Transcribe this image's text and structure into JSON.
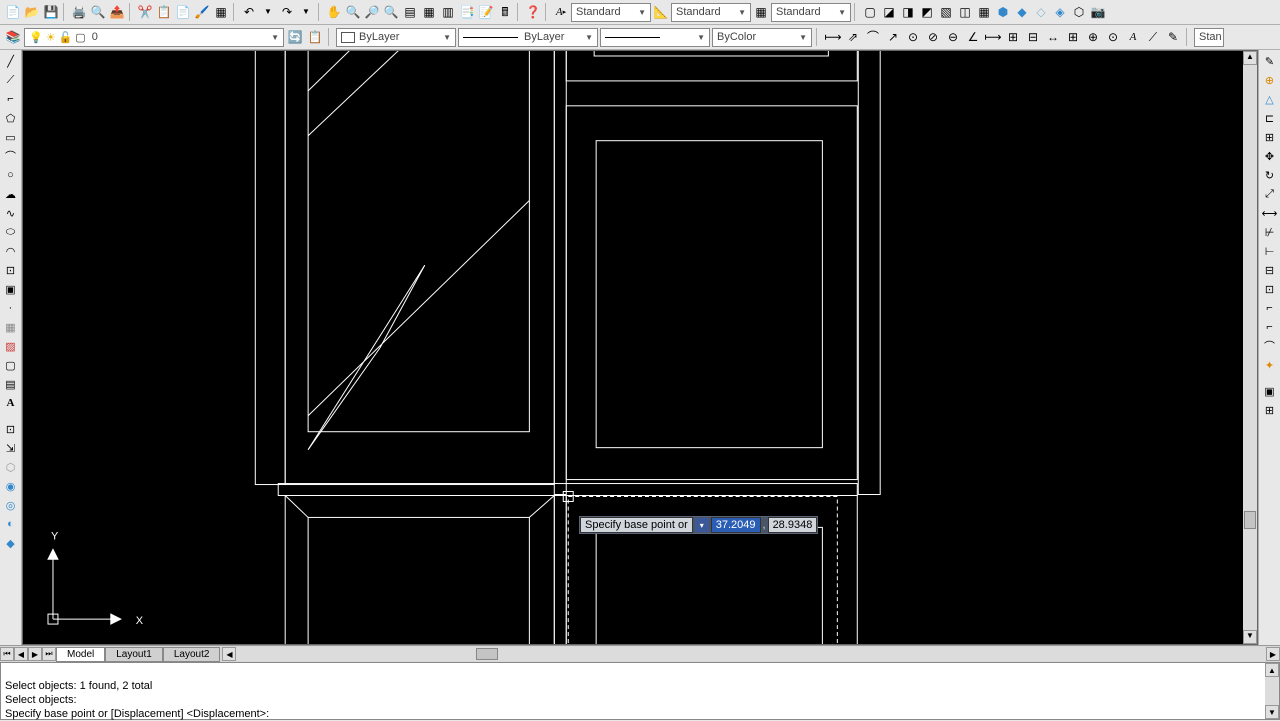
{
  "top_styles": {
    "text": "Standard",
    "dim": "Standard",
    "table": "Standard"
  },
  "layer_row": {
    "layer_dd": "0",
    "linetype_dd": "ByLayer",
    "lineweight_dd": "ByLayer",
    "color_dd": "ByColor"
  },
  "right_style": "Stan",
  "canvas_axis": {
    "x": "X",
    "y": "Y"
  },
  "dynamic_input": {
    "prompt": "Specify base point or",
    "x_value": "37.2049",
    "y_value": "28.9348"
  },
  "tabs": {
    "model": "Model",
    "layout1": "Layout1",
    "layout2": "Layout2"
  },
  "command_lines": {
    "line1": "Select objects: 1 found, 2 total",
    "line2": "Select objects:",
    "line3": "Specify base point or [Displacement] <Displacement>:"
  }
}
